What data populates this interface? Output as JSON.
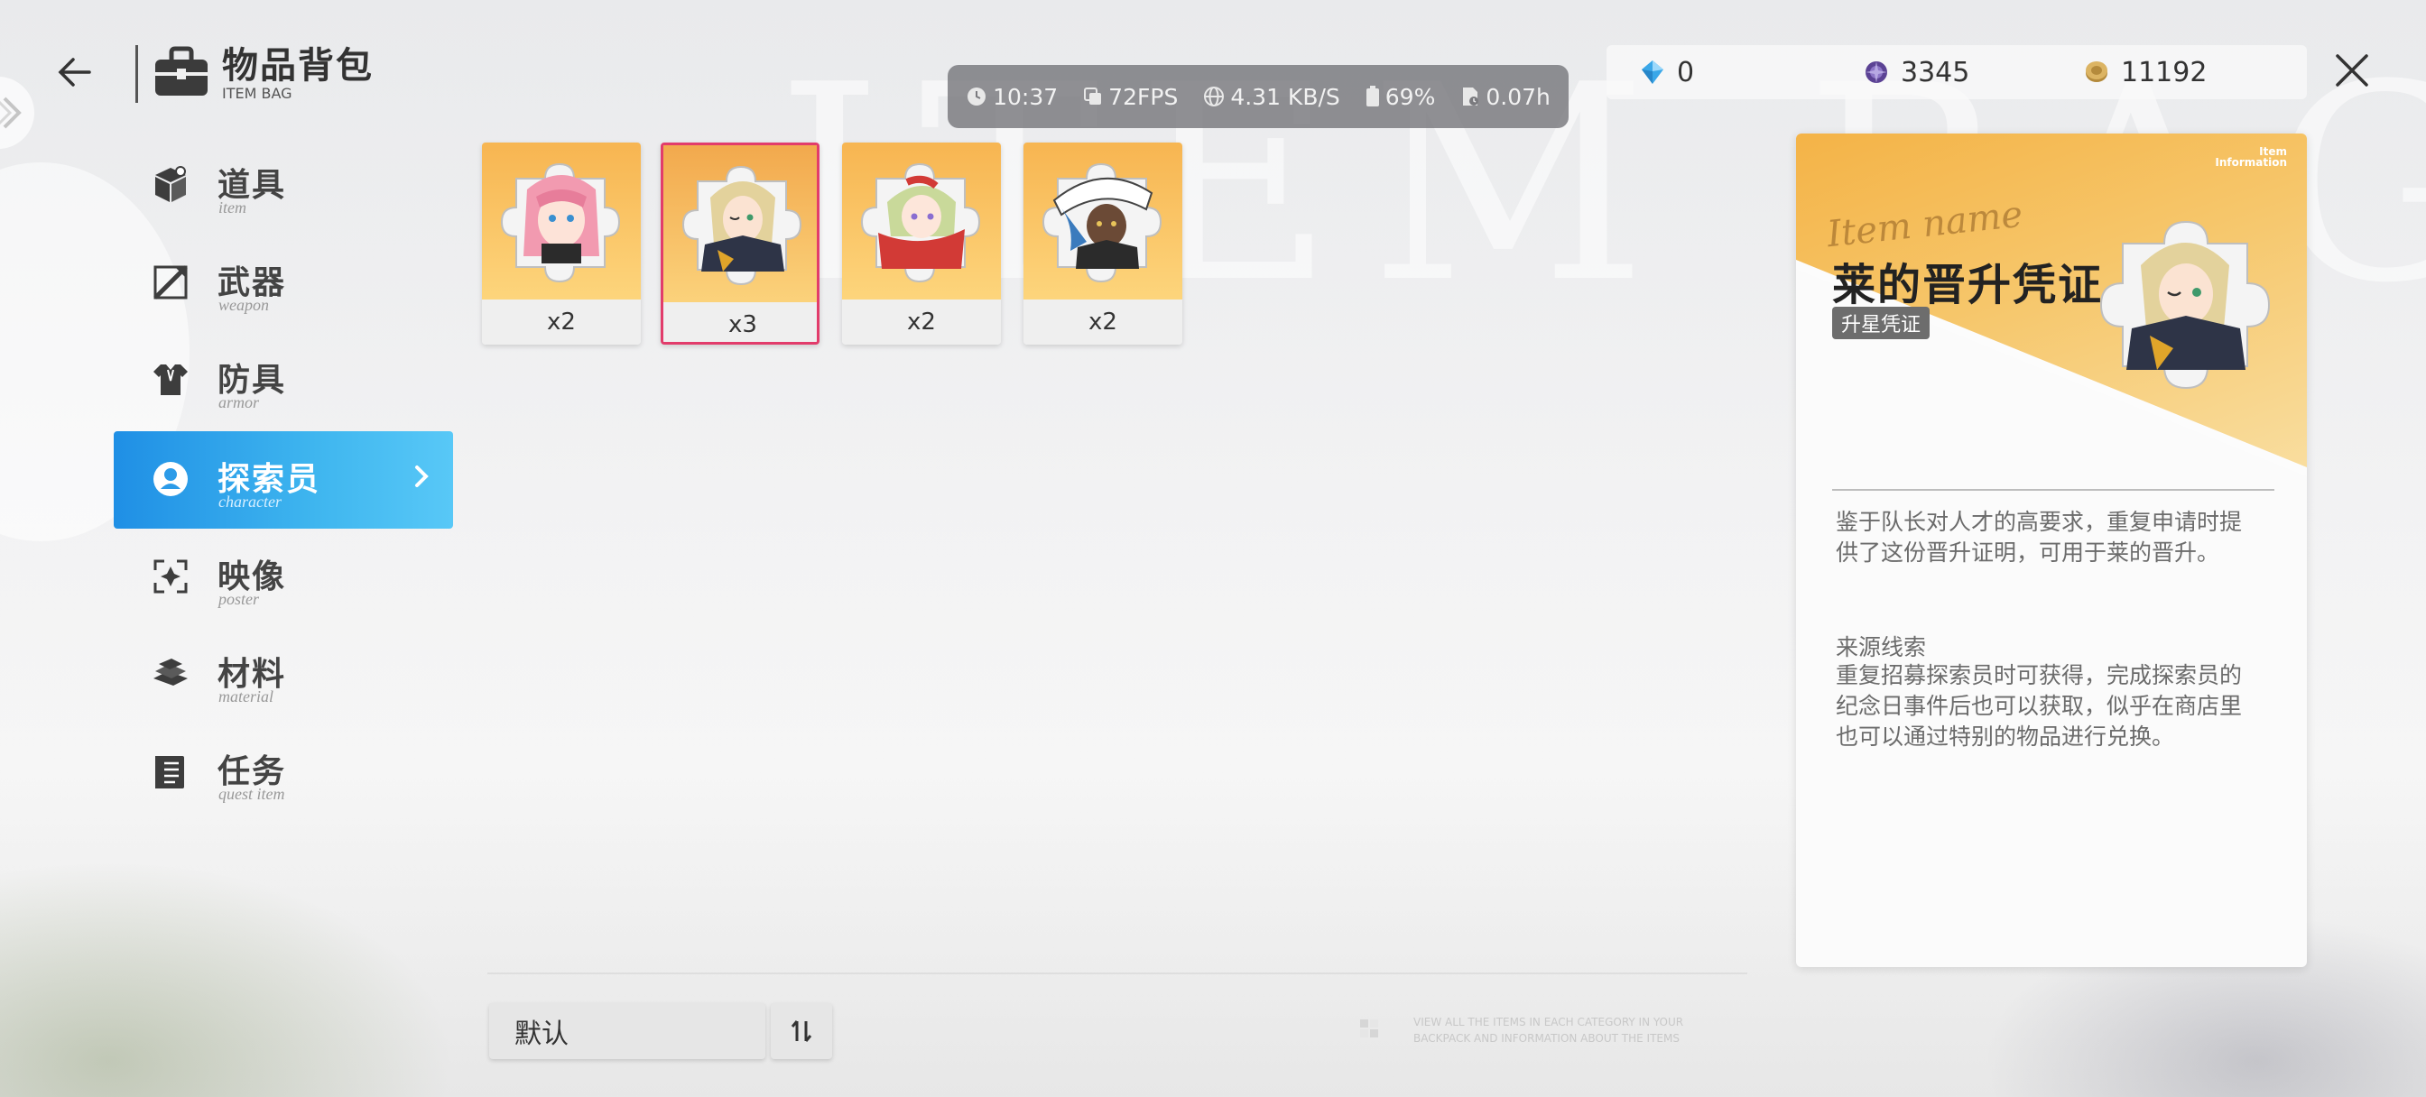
{
  "header": {
    "title": "物品背包",
    "subtitle": "ITEM BAG",
    "watermark": "ITEM BAG"
  },
  "status_bar": {
    "time": "10:37",
    "fps": "72FPS",
    "network": "4.31 KB/S",
    "battery": "69%",
    "playtime": "0.07h"
  },
  "currencies": [
    {
      "icon": "blue-crystal-icon",
      "value": "0",
      "color": "#3aa7e8"
    },
    {
      "icon": "purple-orb-icon",
      "value": "3345",
      "color": "#6a4fa0"
    },
    {
      "icon": "gold-coin-icon",
      "value": "11192",
      "color": "#c9a04a"
    }
  ],
  "sidebar": {
    "items": [
      {
        "label": "道具",
        "sub": "item",
        "icon": "box-icon",
        "active": false
      },
      {
        "label": "武器",
        "sub": "weapon",
        "icon": "weapon-icon",
        "active": false
      },
      {
        "label": "防具",
        "sub": "armor",
        "icon": "armor-icon",
        "active": false
      },
      {
        "label": "探索员",
        "sub": "character",
        "icon": "character-icon",
        "active": true
      },
      {
        "label": "映像",
        "sub": "poster",
        "icon": "poster-icon",
        "active": false
      },
      {
        "label": "材料",
        "sub": "material",
        "icon": "material-icon",
        "active": false
      },
      {
        "label": "任务",
        "sub": "quest item",
        "icon": "quest-icon",
        "active": false
      }
    ]
  },
  "items": [
    {
      "qty": "x2",
      "portrait": "pink-hair-character",
      "selected": false
    },
    {
      "qty": "x3",
      "portrait": "blonde-hair-character",
      "selected": true
    },
    {
      "qty": "x2",
      "portrait": "red-scarf-character",
      "selected": false
    },
    {
      "qty": "x2",
      "portrait": "white-hat-character",
      "selected": false
    }
  ],
  "bottom": {
    "sort_label": "默认",
    "hint": "VIEW ALL THE ITEMS IN EACH CATEGORY IN YOUR BACKPACK AND INFORMATION ABOUT THE ITEMS"
  },
  "detail": {
    "info_tag_line1": "Item",
    "info_tag_line2": "Information",
    "name_deco": "Item name",
    "name": "莱的晋升凭证",
    "type": "升星凭证",
    "description": "鉴于队长对人才的高要求，重复申请时提供了这份晋升证明，可用于莱的晋升。",
    "source_title": "来源线索",
    "source_description": "重复招募探索员时可获得，完成探索员的纪念日事件后也可以获取，似乎在商店里也可以通过特别的物品进行兑换。"
  }
}
